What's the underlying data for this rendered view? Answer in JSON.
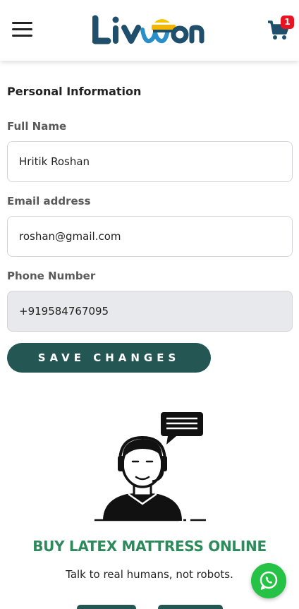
{
  "header": {
    "logo_text": "Livon",
    "cart_count": "1",
    "menu_icon": "hamburger-menu-icon",
    "cart_icon": "shopping-cart-icon"
  },
  "form": {
    "section_title": "Personal Information",
    "full_name_label": "Full Name",
    "full_name_value": "Hritik Roshan",
    "email_label": "Email address",
    "email_value": "roshan@gmail.com",
    "phone_label": "Phone Number",
    "phone_value": "+919584767095",
    "save_label": "SAVE CHANGES"
  },
  "promo": {
    "illustration": "customer-support-agent-illustration",
    "title": "BUY LATEX MATTRESS ONLINE",
    "subtitle": "Talk to real humans, not robots."
  },
  "floating": {
    "whatsapp_icon": "whatsapp-icon"
  },
  "colors": {
    "brand_dark": "#245754",
    "logo_blue": "#1f4f6b",
    "promo_green": "#2c8a5b",
    "badge_red": "#e81422",
    "whatsapp_green": "#25c245"
  }
}
